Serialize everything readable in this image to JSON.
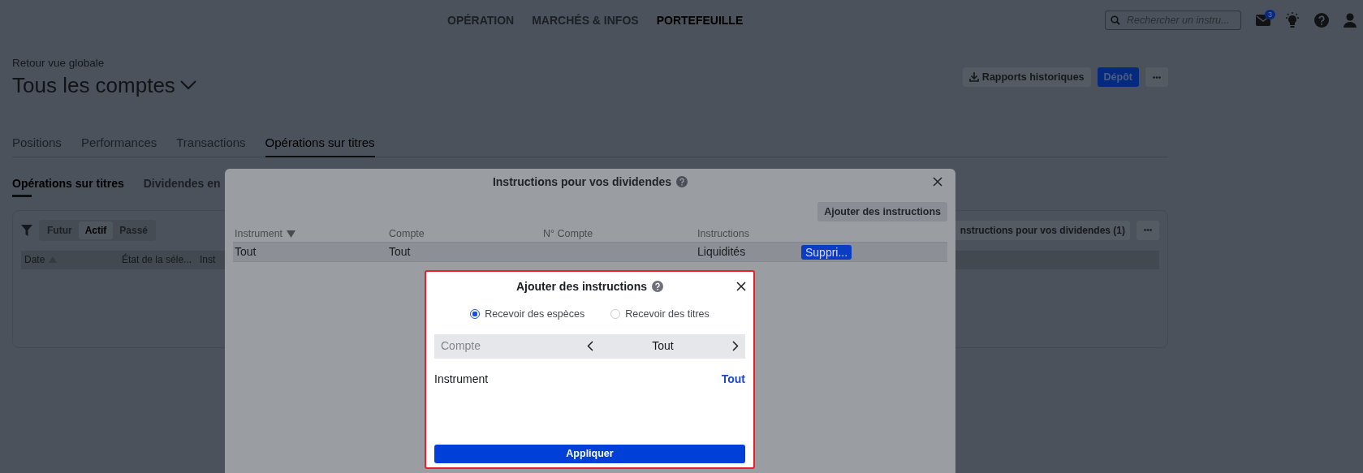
{
  "top_nav": {
    "items": [
      {
        "label": "OPÉRATION",
        "selected": false
      },
      {
        "label": "MARCHÉS & INFOS",
        "selected": false
      },
      {
        "label": "PORTEFEUILLE",
        "selected": true
      }
    ],
    "search": {
      "placeholder": "Rechercher un instru..."
    },
    "mail_badge": "3"
  },
  "header": {
    "back_link": "Retour vue globale",
    "title": "Tous les comptes",
    "reports_button": "Rapports historiques",
    "deposit_button": "Dépôt"
  },
  "tabs": [
    {
      "label": "Positions",
      "selected": false
    },
    {
      "label": "Performances",
      "selected": false
    },
    {
      "label": "Transactions",
      "selected": false
    },
    {
      "label": "Opérations sur titres",
      "selected": true
    }
  ],
  "subtabs": [
    {
      "label": "Opérations sur titres",
      "selected": true
    },
    {
      "label": "Dividendes en",
      "selected": false
    }
  ],
  "panel": {
    "filters": [
      {
        "label": "Futur",
        "selected": false
      },
      {
        "label": "Actif",
        "selected": true
      },
      {
        "label": "Passé",
        "selected": false
      }
    ],
    "dividend_button": "nstructions pour vos dividendes (1)",
    "columns": [
      "Date",
      "État de la séle...",
      "Inst"
    ]
  },
  "dividend_modal": {
    "title": "Instructions pour vos dividendes",
    "add_button": "Ajouter des instructions",
    "columns": [
      "Instrument",
      "Compte",
      "N° Compte",
      "Instructions"
    ],
    "rows": [
      {
        "instrument": "Tout",
        "account": "Tout",
        "instructions": "Liquidités",
        "delete_button": "Suppri..."
      }
    ]
  },
  "add_dialog": {
    "title": "Ajouter des instructions",
    "options": [
      {
        "label": "Recevoir des espèces",
        "selected": true
      },
      {
        "label": "Recevoir des titres",
        "selected": false
      }
    ],
    "account": {
      "label": "Compte",
      "value": "Tout"
    },
    "instrument": {
      "label": "Instrument",
      "value": "Tout"
    },
    "apply_button": "Appliquer"
  }
}
